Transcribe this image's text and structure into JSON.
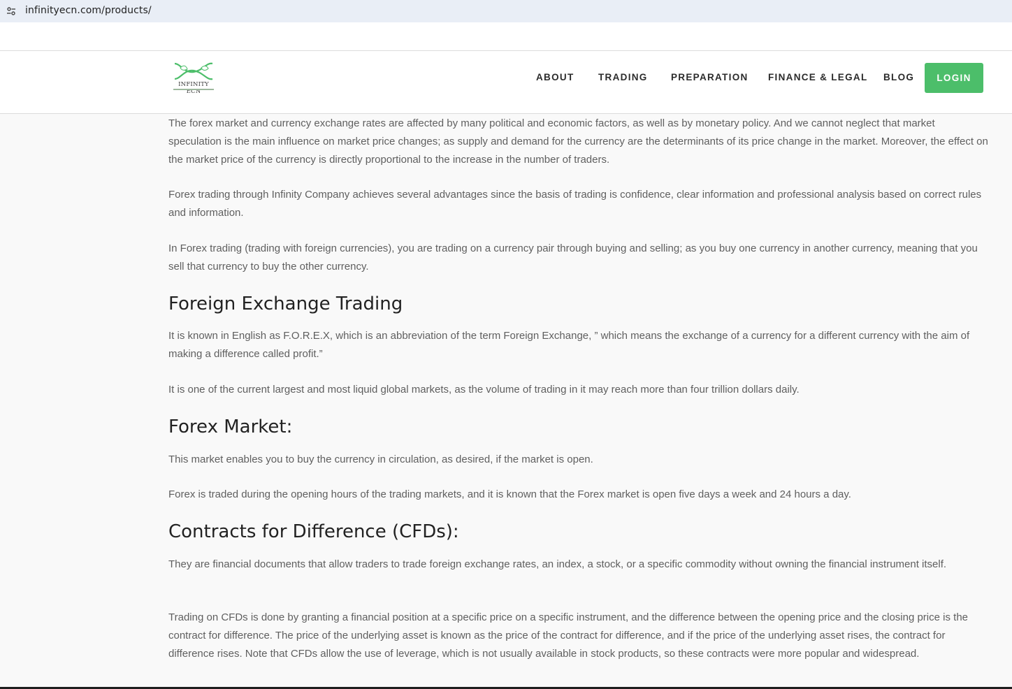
{
  "browser": {
    "url": "infinityecn.com/products/",
    "site_info_icon": "tune-icon"
  },
  "logo": {
    "text": "INFINITY ECN",
    "brand_color": "#4cbe6a"
  },
  "nav": {
    "items": [
      {
        "label": "ABOUT"
      },
      {
        "label": "TRADING"
      },
      {
        "label": "PREPARATION"
      },
      {
        "label": "FINANCE & LEGAL"
      },
      {
        "label": "BLOG"
      }
    ],
    "login_label": "LOGIN"
  },
  "content": {
    "paragraphs_intro": [
      "The forex market and currency exchange rates are affected by many political and economic factors, as well as by monetary policy. And we cannot neglect that market speculation is the main influence on market price changes; as supply and demand for the currency are the determinants of its price change in the market. Moreover, the effect on the market price of the currency is directly proportional to the increase in the number of traders.",
      "Forex trading through Infinity Company achieves several advantages since the basis of trading is confidence, clear information and professional analysis based on correct rules and information.",
      "In Forex trading (trading with foreign currencies), you are trading on a currency pair through buying and selling; as you buy one currency in another currency, meaning that you sell that currency to buy the other currency."
    ],
    "section1": {
      "heading": "Foreign Exchange Trading",
      "paragraphs": [
        "It is known in English as F.O.R.E.X, which is an abbreviation of the term Foreign Exchange, ” which means the exchange of a currency for a different currency with the aim of making a difference called profit.”",
        "It is one of the current largest and most liquid global markets, as the volume of trading in it may reach more than four trillion dollars daily."
      ]
    },
    "section2": {
      "heading": "Forex Market:",
      "paragraphs": [
        "This market enables you to buy the currency in circulation, as desired, if the market is open.",
        "Forex is traded during the opening hours of the trading markets, and it is known that the Forex market is open five days a week and 24 hours a day."
      ]
    },
    "section3": {
      "heading": "Contracts for Difference (CFDs):",
      "paragraphs": [
        "They are financial documents that allow traders to trade foreign exchange rates, an index, a stock, or a specific commodity without owning the financial instrument itself.",
        "Trading on CFDs is done by granting a financial position at a specific price on a specific instrument, and the difference between the opening price and the closing price is the contract for difference. The price of the underlying asset is known as the price of the contract for difference, and if the price of the underlying asset rises, the contract for difference rises. Note that CFDs allow the use of leverage, which is not usually available in stock products, so these contracts were more popular and widespread."
      ]
    }
  }
}
